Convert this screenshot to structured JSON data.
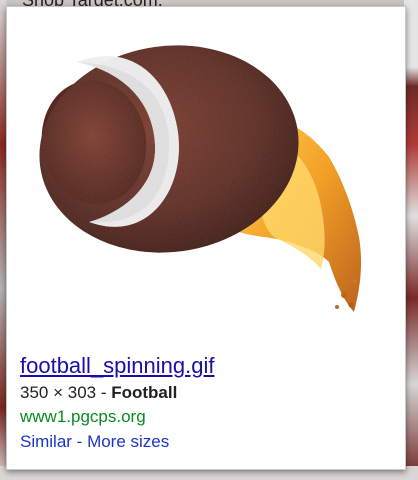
{
  "background": {
    "top_text": "Shop Target.com."
  },
  "result": {
    "title": "football_spinning.gif",
    "dimensions": "350 × 303",
    "separator": " - ",
    "query": "Football",
    "domain": "www1.pgcps.org",
    "similar_label": "Similar",
    "links_separator": " - ",
    "more_sizes_label": "More sizes"
  },
  "colors": {
    "link_blue": "#1a0dab",
    "domain_green": "#0b8a1f",
    "ball_brown": "#5b2a20",
    "flame_orange": "#f29a1a"
  }
}
